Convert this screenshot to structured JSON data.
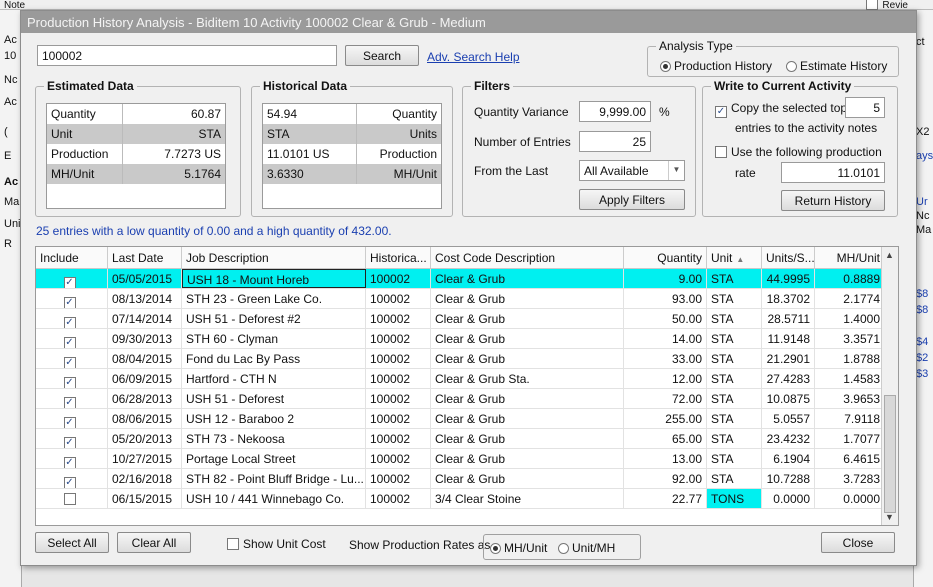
{
  "background": {
    "top_label": "Note",
    "top_right_label": "Revie",
    "left_labels": [
      "Ac",
      "10",
      "Nc",
      "Ac",
      "(",
      "E",
      "Ac",
      "Ma",
      "Uni",
      "R"
    ],
    "right_labels": [
      "ct",
      "X2",
      "ays",
      "Ur",
      "Nc",
      "Ma",
      "$8",
      "$8",
      "$4",
      "$2",
      "$3"
    ]
  },
  "dialog": {
    "title": "Production History Analysis - Biditem 10 Activity 100002 Clear & Grub - Medium"
  },
  "search": {
    "value": "100002",
    "button_label": "Search",
    "adv_link": "Adv. Search Help"
  },
  "analysis_type": {
    "legend": "Analysis Type",
    "options": [
      "Production History",
      "Estimate History"
    ],
    "selected": "Production History"
  },
  "estimated": {
    "legend": "Estimated Data",
    "rows": [
      {
        "label": "Quantity",
        "value": "60.87"
      },
      {
        "label": "Unit",
        "value": "STA"
      },
      {
        "label": "Production",
        "value": "7.7273 US"
      },
      {
        "label": "MH/Unit",
        "value": "5.1764"
      }
    ]
  },
  "historical": {
    "legend": "Historical Data",
    "rows": [
      {
        "value": "54.94",
        "label": "Quantity"
      },
      {
        "value": "STA",
        "label": "Units"
      },
      {
        "value": "11.0101 US",
        "label": "Production"
      },
      {
        "value": "3.6330",
        "label": "MH/Unit"
      }
    ]
  },
  "filters": {
    "legend": "Filters",
    "qty_variance_label": "Quantity Variance",
    "qty_variance_value": "9,999.00",
    "qty_variance_unit": "%",
    "entries_label": "Number of Entries",
    "entries_value": "25",
    "from_last_label": "From the Last",
    "from_last_value": "All Available",
    "apply_label": "Apply Filters"
  },
  "write": {
    "legend": "Write to Current Activity",
    "copy_label": "Copy the selected top",
    "copy_value": "5",
    "copy_label2": "entries to the activity notes",
    "use_label": "Use the following production",
    "rate_label": "rate",
    "rate_value": "11.0101",
    "return_label": "Return History"
  },
  "info_text": "25 entries with a low quantity of 0.00 and a high quantity of 432.00.",
  "table": {
    "headers": [
      "Include",
      "Last Date",
      "Job Description",
      "Historica...",
      "Cost Code Description",
      "Quantity",
      "Unit",
      "Units/S...",
      "MH/Unit"
    ],
    "rows": [
      {
        "include": true,
        "date": "05/05/2015",
        "job": "USH 18 - Mount Horeb",
        "hist": "100002",
        "cc": "Clear & Grub",
        "qty": "9.00",
        "unit": "STA",
        "us": "44.9995",
        "mh": "0.8889"
      },
      {
        "include": true,
        "date": "08/13/2014",
        "job": "STH 23 - Green Lake Co.",
        "hist": "100002",
        "cc": "Clear & Grub",
        "qty": "93.00",
        "unit": "STA",
        "us": "18.3702",
        "mh": "2.1774"
      },
      {
        "include": true,
        "date": "07/14/2014",
        "job": "USH 51 - Deforest #2",
        "hist": "100002",
        "cc": "Clear & Grub",
        "qty": "50.00",
        "unit": "STA",
        "us": "28.5711",
        "mh": "1.4000"
      },
      {
        "include": true,
        "date": "09/30/2013",
        "job": "STH 60 - Clyman",
        "hist": "100002",
        "cc": "Clear & Grub",
        "qty": "14.00",
        "unit": "STA",
        "us": "11.9148",
        "mh": "3.3571"
      },
      {
        "include": true,
        "date": "08/04/2015",
        "job": "Fond du Lac By Pass",
        "hist": "100002",
        "cc": "Clear & Grub",
        "qty": "33.00",
        "unit": "STA",
        "us": "21.2901",
        "mh": "1.8788"
      },
      {
        "include": true,
        "date": "06/09/2015",
        "job": "Hartford - CTH N",
        "hist": "100002",
        "cc": "Clear & Grub Sta.",
        "qty": "12.00",
        "unit": "STA",
        "us": "27.4283",
        "mh": "1.4583"
      },
      {
        "include": true,
        "date": "06/28/2013",
        "job": "USH 51 - Deforest",
        "hist": "100002",
        "cc": "Clear & Grub",
        "qty": "72.00",
        "unit": "STA",
        "us": "10.0875",
        "mh": "3.9653"
      },
      {
        "include": true,
        "date": "08/06/2015",
        "job": "USH 12 - Baraboo 2",
        "hist": "100002",
        "cc": "Clear & Grub",
        "qty": "255.00",
        "unit": "STA",
        "us": "5.0557",
        "mh": "7.9118"
      },
      {
        "include": true,
        "date": "05/20/2013",
        "job": "STH 73 - Nekoosa",
        "hist": "100002",
        "cc": "Clear & Grub",
        "qty": "65.00",
        "unit": "STA",
        "us": "23.4232",
        "mh": "1.7077"
      },
      {
        "include": true,
        "date": "10/27/2015",
        "job": "Portage Local Street",
        "hist": "100002",
        "cc": "Clear & Grub",
        "qty": "13.00",
        "unit": "STA",
        "us": "6.1904",
        "mh": "6.4615"
      },
      {
        "include": true,
        "date": "02/16/2018",
        "job": "STH 82 - Point Bluff Bridge - Lu...",
        "hist": "100002",
        "cc": "Clear & Grub",
        "qty": "92.00",
        "unit": "STA",
        "us": "10.7288",
        "mh": "3.7283"
      },
      {
        "include": false,
        "date": "06/15/2015",
        "job": "USH 10 / 441 Winnebago Co.",
        "hist": "100002",
        "cc": "3/4 Clear Stoine",
        "qty": "22.77",
        "unit": "TONS",
        "us": "0.0000",
        "mh": "0.0000"
      }
    ]
  },
  "footer": {
    "select_all": "Select All",
    "clear_all": "Clear All",
    "show_unit_cost": "Show Unit Cost",
    "show_rates_label": "Show Production Rates as",
    "rate_options": [
      "MH/Unit",
      "Unit/MH"
    ],
    "rate_selected": "MH/Unit",
    "close": "Close"
  },
  "colors": {
    "highlight": "#00f0f0",
    "link": "#1a3fb0",
    "title_bar": "#9a9a9a"
  }
}
